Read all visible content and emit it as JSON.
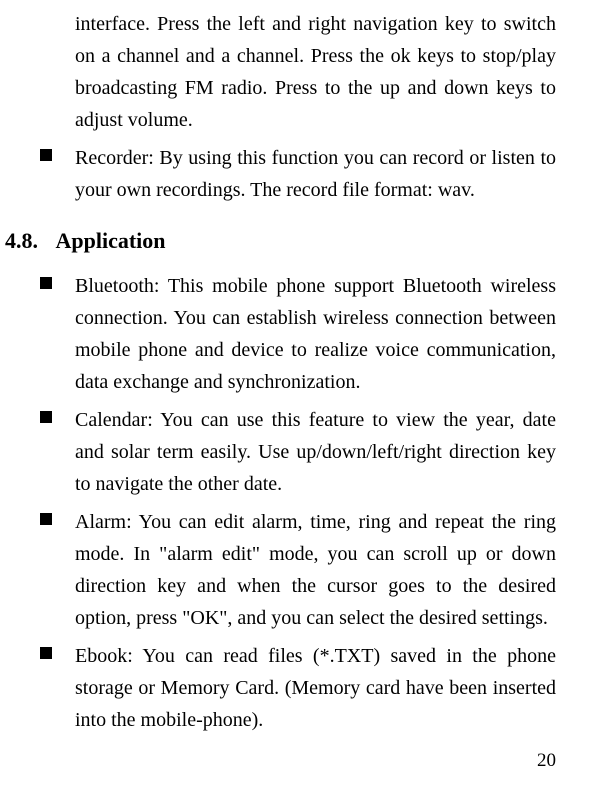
{
  "top_continued": "interface. Press the left and right navigation key to switch on a channel and a channel. Press the ok keys to stop/play broadcasting FM radio. Press to the up and down keys to adjust volume.",
  "top_items": [
    "Recorder: By using this function you can record or listen to your own recordings. The record file format: wav."
  ],
  "section": {
    "number": "4.8.",
    "title": "Application"
  },
  "app_items": [
    "Bluetooth: This mobile phone support Bluetooth wireless connection. You can establish wireless connection between mobile phone and device to realize voice communication, data exchange and synchronization.",
    "Calendar: You can use this feature to view the year, date and solar term easily. Use up/down/left/right direction key to navigate the other date.",
    "Alarm: You can edit alarm, time, ring and repeat the ring mode. In \"alarm edit\" mode, you can scroll up or down direction key and when the cursor goes to the desired option, press \"OK\", and you can select the desired settings.",
    "Ebook: You can read files (*.TXT) saved in the phone storage or Memory Card. (Memory card have been inserted into the mobile-phone)."
  ],
  "page_number": "20"
}
